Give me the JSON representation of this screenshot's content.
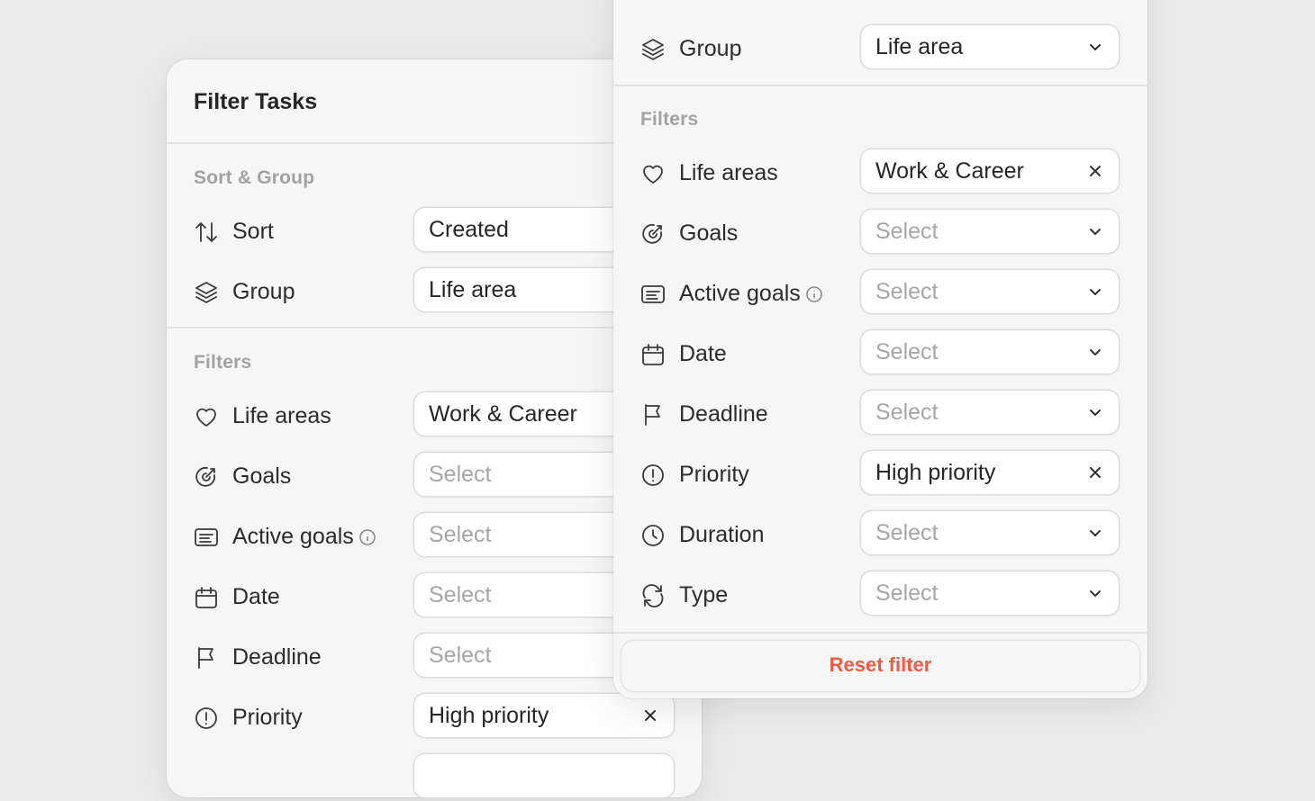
{
  "back_panel": {
    "title": "Filter Tasks",
    "sort_group_label": "Sort & Group",
    "sort": {
      "label": "Sort",
      "value": "Created",
      "icon": "sort-arrows-icon"
    },
    "group": {
      "label": "Group",
      "value": "Life area",
      "icon": "layers-icon"
    },
    "filters_label": "Filters",
    "filters": [
      {
        "label": "Life areas",
        "value": "Work & Career",
        "placeholder": false,
        "icon": "heart-icon"
      },
      {
        "label": "Goals",
        "value": "Select",
        "placeholder": true,
        "icon": "target-icon"
      },
      {
        "label": "Active goals",
        "value": "Select",
        "placeholder": true,
        "icon": "list-card-icon",
        "info": true
      },
      {
        "label": "Date",
        "value": "Select",
        "placeholder": true,
        "icon": "calendar-icon"
      },
      {
        "label": "Deadline",
        "value": "Select",
        "placeholder": true,
        "icon": "flag-icon"
      },
      {
        "label": "Priority",
        "value": "High priority",
        "placeholder": false,
        "icon": "exclamation-circle-icon",
        "clearable": true
      }
    ]
  },
  "front_panel": {
    "group": {
      "label": "Group",
      "value": "Life area",
      "icon": "layers-icon"
    },
    "filters_label": "Filters",
    "filters": [
      {
        "label": "Life areas",
        "value": "Work & Career",
        "placeholder": false,
        "icon": "heart-icon",
        "action": "clear"
      },
      {
        "label": "Goals",
        "value": "Select",
        "placeholder": true,
        "icon": "target-icon",
        "action": "dropdown"
      },
      {
        "label": "Active goals",
        "value": "Select",
        "placeholder": true,
        "icon": "list-card-icon",
        "info": true,
        "action": "dropdown"
      },
      {
        "label": "Date",
        "value": "Select",
        "placeholder": true,
        "icon": "calendar-icon",
        "action": "dropdown"
      },
      {
        "label": "Deadline",
        "value": "Select",
        "placeholder": true,
        "icon": "flag-icon",
        "action": "dropdown"
      },
      {
        "label": "Priority",
        "value": "High priority",
        "placeholder": false,
        "icon": "exclamation-circle-icon",
        "action": "clear"
      },
      {
        "label": "Duration",
        "value": "Select",
        "placeholder": true,
        "icon": "clock-icon",
        "action": "dropdown"
      },
      {
        "label": "Type",
        "value": "Select",
        "placeholder": true,
        "icon": "repeat-icon",
        "action": "dropdown"
      }
    ],
    "reset_label": "Reset filter"
  },
  "colors": {
    "accent_red": "#ee5a46",
    "panel_bg": "#f6f6f6",
    "page_bg": "#ececec"
  }
}
